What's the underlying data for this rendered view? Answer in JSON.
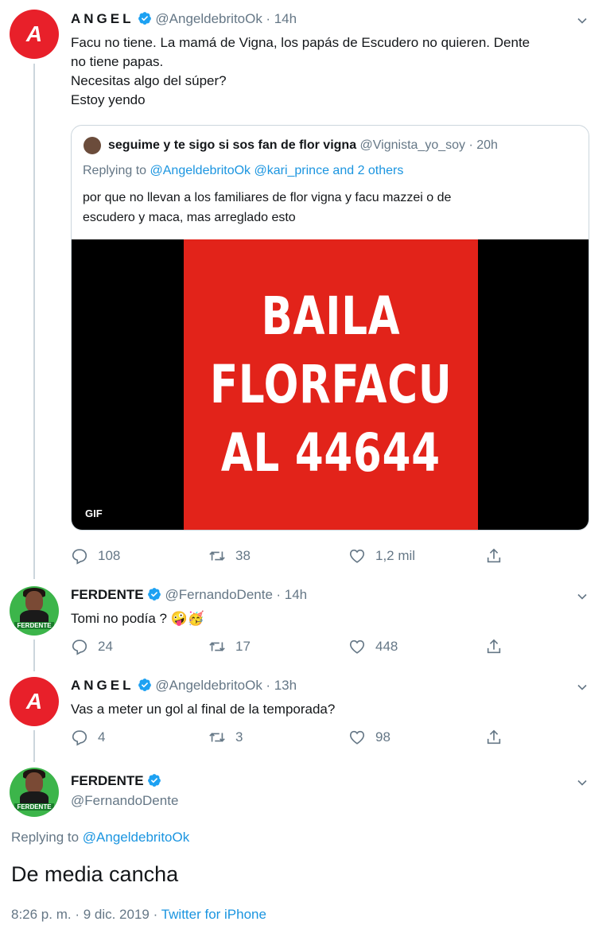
{
  "tweet1": {
    "avatar_letter": "A",
    "name": "ANGEL",
    "handle": "@AngeldebritoOk",
    "time": "· 14h",
    "lines": [
      "Facu no tiene. La mamá de Vigna, los papás de Escudero no quieren. Dente",
      "no tiene papas.",
      "Necesitas algo del súper?",
      "Estoy yendo"
    ],
    "quote": {
      "name": "seguime y te sigo si sos fan de flor vigna",
      "handle": "@Vignista_yo_soy",
      "time": "· 20h",
      "replying_prefix": "Replying to",
      "replying_to": "@AngeldebritoOk @kari_prince and 2 others",
      "lines": [
        "por que no llevan a los familiares de flor vigna y facu mazzei o de",
        "escudero y maca, mas arreglado esto"
      ],
      "gif_lines": [
        "BAILA",
        "FLORFACU",
        "AL 44644"
      ],
      "gif_badge": "GIF"
    },
    "replies": "108",
    "retweets": "38",
    "likes": "1,2 mil"
  },
  "tweet2": {
    "name": "FERDENTE",
    "avatar_label": "FERDENTE",
    "handle": "@FernandoDente",
    "time": "· 14h",
    "text": "Tomi no podía ? 🤪🥳",
    "replies": "24",
    "retweets": "17",
    "likes": "448"
  },
  "tweet3": {
    "avatar_letter": "A",
    "name": "ANGEL",
    "handle": "@AngeldebritoOk",
    "time": "· 13h",
    "text": "Vas a meter un gol al final de la temporada?",
    "replies": "4",
    "retweets": "3",
    "likes": "98"
  },
  "tweet4": {
    "name": "FERDENTE",
    "avatar_label": "FERDENTE",
    "handle": "@FernandoDente",
    "replying_prefix": "Replying to",
    "replying_to": "@AngeldebritoOk",
    "text": "De media cancha",
    "timestamp": "8:26 p. m. · 9 dic. 2019 ·",
    "source": "Twitter for iPhone"
  },
  "colors": {
    "link": "#1b95e0",
    "secondary_text": "#657786",
    "verified": "#1da1f2",
    "angel_red": "#e8202a",
    "gif_red": "#e2231a"
  },
  "icons": [
    "reply-icon",
    "retweet-icon",
    "like-icon",
    "share-icon",
    "verified-icon",
    "chevron-down-icon"
  ]
}
